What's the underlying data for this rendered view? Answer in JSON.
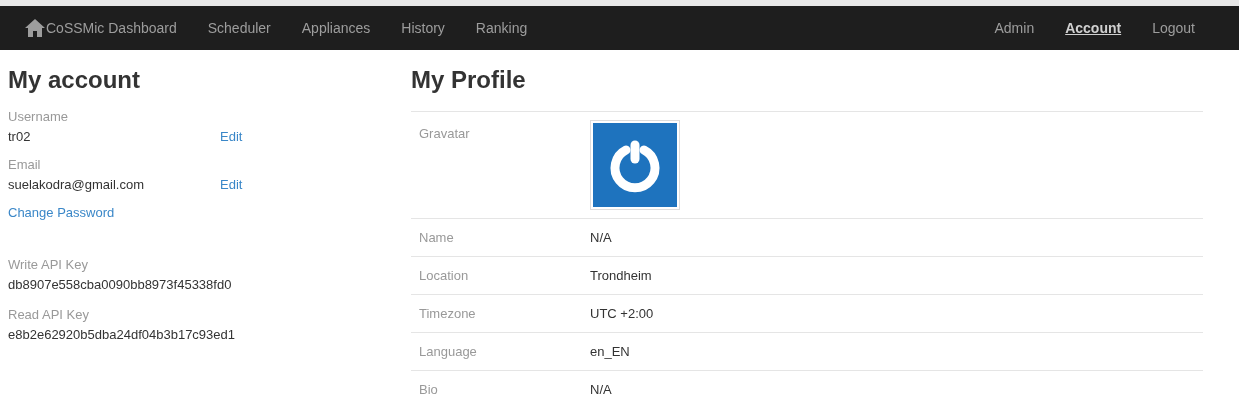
{
  "navbar": {
    "brand": "CoSSMic Dashboard",
    "left_items": [
      {
        "label": "Scheduler",
        "selected": false
      },
      {
        "label": "Appliances",
        "selected": false
      },
      {
        "label": "History",
        "selected": false
      },
      {
        "label": "Ranking",
        "selected": false
      }
    ],
    "right_items": [
      {
        "label": "Admin",
        "selected": false
      },
      {
        "label": "Account",
        "selected": true
      },
      {
        "label": "Logout",
        "selected": false
      }
    ]
  },
  "account": {
    "title": "My account",
    "fields": [
      {
        "label": "Username",
        "value": "tr02",
        "action": "Edit"
      },
      {
        "label": "Email",
        "value": "suelakodra@gmail.com",
        "action": "Edit"
      }
    ],
    "change_password": "Change Password",
    "api_keys": [
      {
        "label": "Write API Key",
        "value": "db8907e558cba0090bb8973f45338fd0"
      },
      {
        "label": "Read API Key",
        "value": "e8b2e62920b5dba24df04b3b17c93ed1"
      }
    ]
  },
  "profile": {
    "title": "My Profile",
    "rows": [
      {
        "label": "Gravatar",
        "kind": "avatar"
      },
      {
        "label": "Name",
        "kind": "text",
        "value": "N/A"
      },
      {
        "label": "Location",
        "kind": "text",
        "value": "Trondheim"
      },
      {
        "label": "Timezone",
        "kind": "text",
        "value": "UTC +2:00"
      },
      {
        "label": "Language",
        "kind": "text",
        "value": "en_EN"
      },
      {
        "label": "Bio",
        "kind": "text",
        "value": "N/A"
      }
    ]
  }
}
